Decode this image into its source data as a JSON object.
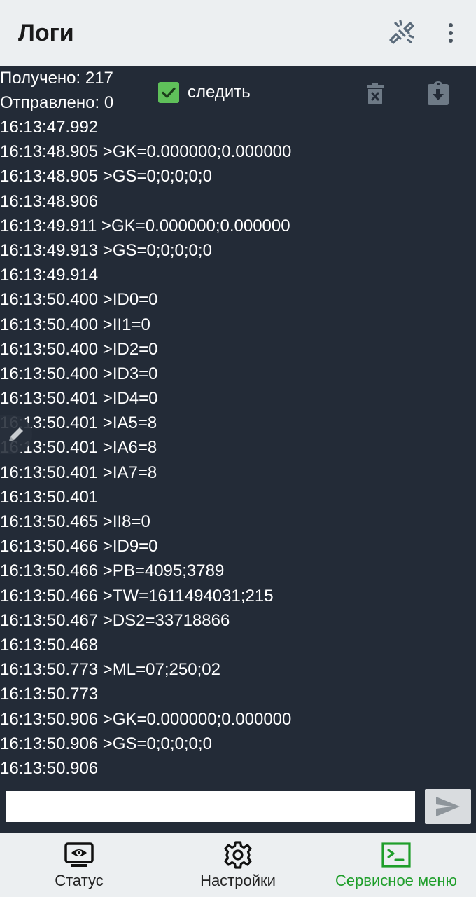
{
  "appbar": {
    "title": "Логи",
    "icons": {
      "link": "link-off-icon",
      "more": "more-vert-icon"
    }
  },
  "log": {
    "received_label": "Получено: 217",
    "sent_label": "Отправлено: 0",
    "follow": {
      "label": "следить",
      "checked": true
    },
    "icons": {
      "clear": "trash-x-icon",
      "save": "clipboard-download-icon"
    },
    "lines": [
      "16:13:47.992",
      "16:13:48.905 >GK=0.000000;0.000000",
      "16:13:48.905 >GS=0;0;0;0;0",
      "16:13:48.906",
      "16:13:49.911 >GK=0.000000;0.000000",
      "16:13:49.913 >GS=0;0;0;0;0",
      "16:13:49.914",
      "16:13:50.400 >ID0=0",
      "16:13:50.400 >II1=0",
      "16:13:50.400 >ID2=0",
      "16:13:50.400 >ID3=0",
      "16:13:50.401 >ID4=0",
      "16:13:50.401 >IA5=8",
      "16:13:50.401 >IA6=8",
      "16:13:50.401 >IA7=8",
      "16:13:50.401",
      "16:13:50.465 >II8=0",
      "16:13:50.466 >ID9=0",
      "16:13:50.466 >PB=4095;3789",
      "16:13:50.466 >TW=1611494031;215",
      "16:13:50.467 >DS2=33718866",
      "16:13:50.468",
      "16:13:50.773 >ML=07;250;02",
      "16:13:50.773",
      "16:13:50.906 >GK=0.000000;0.000000",
      "16:13:50.906 >GS=0;0;0;0;0",
      "16:13:50.906"
    ]
  },
  "input": {
    "value": "",
    "placeholder": "",
    "send_icon": "send-icon"
  },
  "nav": {
    "active": "service",
    "items": [
      {
        "key": "status",
        "label": "Статус",
        "icon": "monitor-eye-icon"
      },
      {
        "key": "settings",
        "label": "Настройки",
        "icon": "gear-icon"
      },
      {
        "key": "service",
        "label": "Сервисное меню",
        "icon": "terminal-icon"
      }
    ]
  },
  "colors": {
    "appbar_bg": "#eceff1",
    "log_bg": "#232b37",
    "checkbox": "#5fc05a",
    "active_nav": "#1e9e2a"
  }
}
